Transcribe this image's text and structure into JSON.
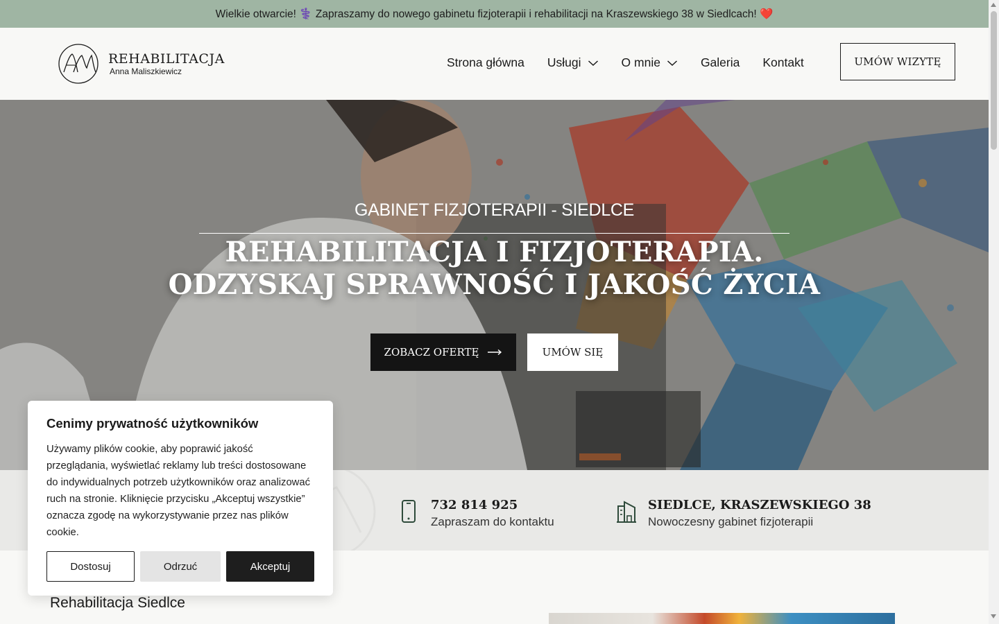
{
  "announcement": {
    "text": "Wielkie otwarcie! ⚕️ Zapraszamy do nowego gabinetu fizjoterapii i rehabilitacji na Kraszewskiego 38 w Siedlcach! ❤️"
  },
  "header": {
    "logo_title": "REHABILITACJA",
    "logo_subtitle": "Anna Maliszkiewicz",
    "nav": [
      {
        "label": "Strona główna"
      },
      {
        "label": "Usługi"
      },
      {
        "label": "O mnie"
      },
      {
        "label": "Galeria"
      },
      {
        "label": "Kontakt"
      }
    ],
    "cta_label": "UMÓW WIZYTĘ"
  },
  "hero": {
    "subtitle": "GABINET FIZJOTERAPII - SIEDLCE",
    "title_line1": "REHABILITACJA I FIZJOTERAPIA.",
    "title_line2": "ODZYSKAJ SPRAWNOŚĆ I JAKOŚĆ ŻYCIA",
    "btn_offer": "ZOBACZ OFERTĘ",
    "btn_book": "UMÓW SIĘ"
  },
  "info": {
    "phone_title": "732 814 925",
    "phone_desc": "Zapraszam do kontaktu",
    "address_title": "SIEDLCE, KRASZEWSKIEGO 38",
    "address_desc": "Nowoczesny gabinet fizjoterapii"
  },
  "content": {
    "section_title": "Rehabilitacja Siedlce"
  },
  "cookie": {
    "title": "Cenimy prywatność użytkowników",
    "text": "Używamy plików cookie, aby poprawić jakość przeglądania, wyświetlać reklamy lub treści dostosowane do indywidualnych potrzeb użytkowników oraz analizować ruch na stronie. Kliknięcie przycisku „Akceptuj wszystkie” oznacza zgodę na wykorzystywanie przez nas plików cookie.",
    "btn_customize": "Dostosuj",
    "btn_reject": "Odrzuć",
    "btn_accept": "Akceptuj"
  },
  "colors": {
    "announcement_bg": "#9fb5a3",
    "dark_button": "#141414",
    "info_bg": "#e9e9e7",
    "icon_green": "#2e4a3a"
  }
}
